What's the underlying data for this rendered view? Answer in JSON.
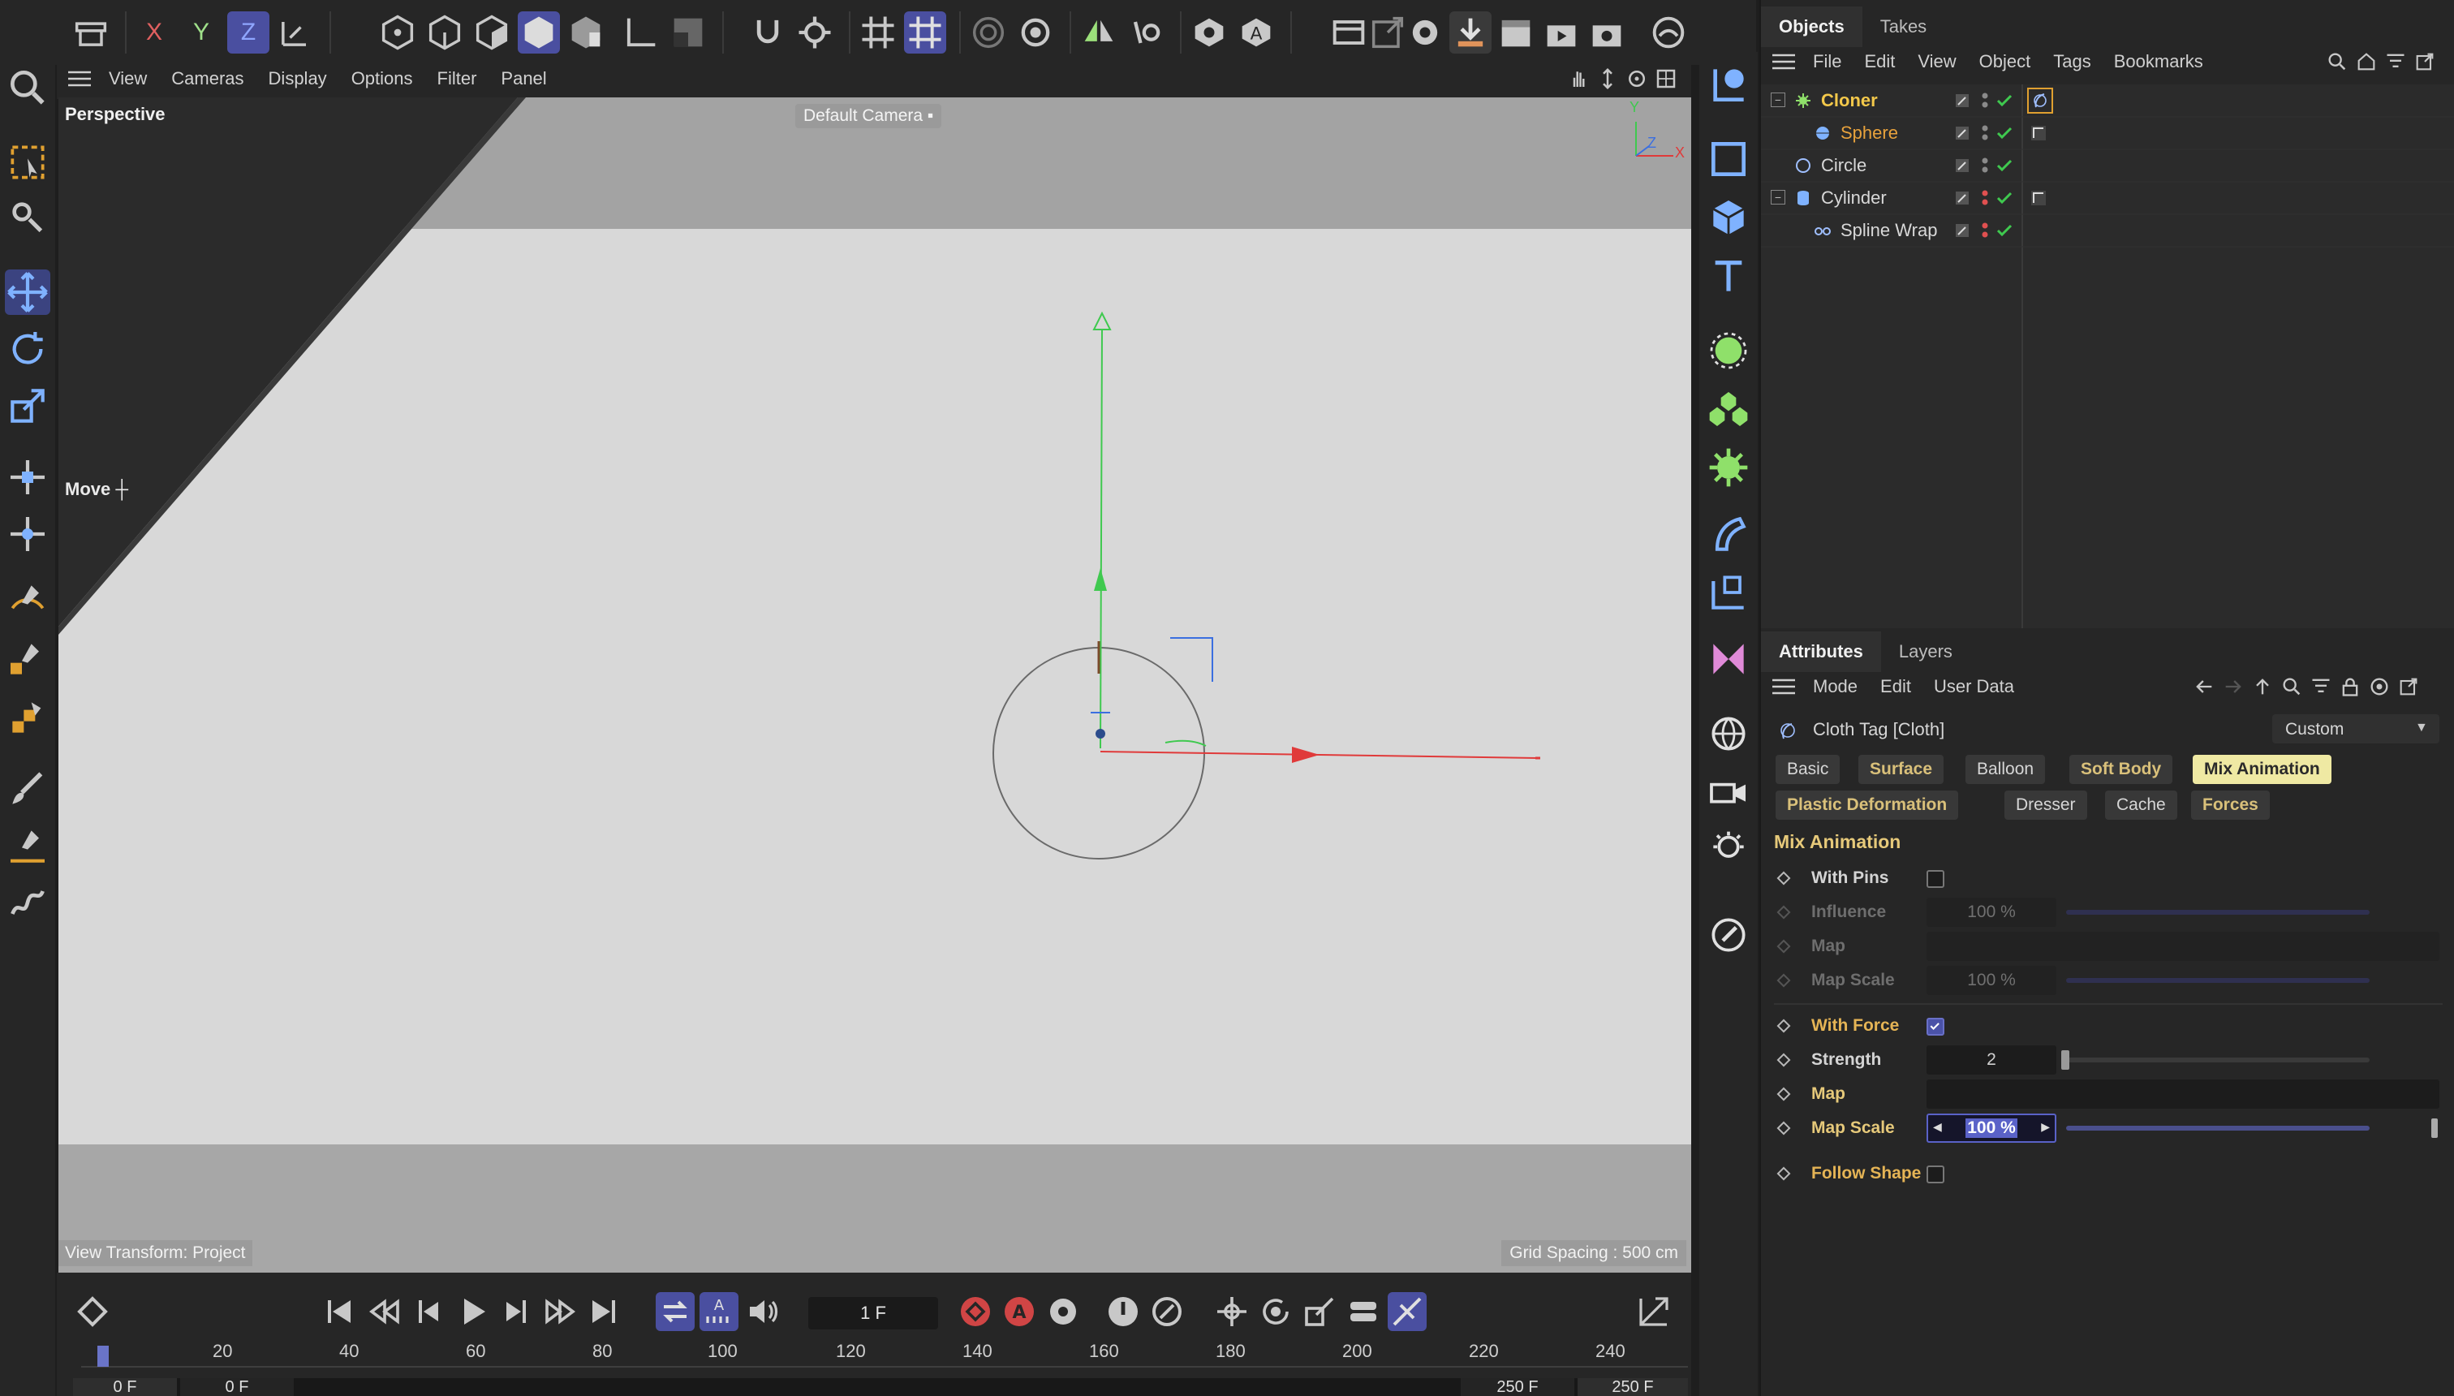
{
  "viewport": {
    "menu": [
      "View",
      "Cameras",
      "Display",
      "Options",
      "Filter",
      "Panel"
    ],
    "view_name": "Perspective",
    "camera": "Default Camera",
    "tool_name": "Move",
    "view_transform": "View Transform: Project",
    "grid_spacing": "Grid Spacing : 500 cm",
    "axes": {
      "y": "Y",
      "z": "Z",
      "x": "X"
    }
  },
  "top_toolbar": {
    "axis_buttons": [
      "X",
      "Y",
      "Z"
    ]
  },
  "timeline": {
    "current_frame": "1 F",
    "ruler_ticks": [
      "20",
      "40",
      "60",
      "80",
      "100",
      "120",
      "140",
      "160",
      "180",
      "200",
      "220",
      "240"
    ],
    "range_start": "0 F",
    "range_start_2": "0 F",
    "range_end": "250 F",
    "range_end_2": "250 F"
  },
  "objects_panel": {
    "tabs": [
      "Objects",
      "Takes"
    ],
    "menu": [
      "File",
      "Edit",
      "View",
      "Object",
      "Tags",
      "Bookmarks"
    ],
    "rows": [
      {
        "name": "Cloner"
      },
      {
        "name": "Sphere"
      },
      {
        "name": "Circle"
      },
      {
        "name": "Cylinder"
      },
      {
        "name": "Spline Wrap"
      }
    ]
  },
  "attributes_panel": {
    "tabs": [
      "Attributes",
      "Layers"
    ],
    "menu": [
      "Mode",
      "Edit",
      "User Data"
    ],
    "object_title": "Cloth Tag [Cloth]",
    "preset": "Custom",
    "tab_buttons_row1": [
      "Basic",
      "Surface",
      "Balloon",
      "Soft Body",
      "Mix Animation"
    ],
    "tab_buttons_row2": [
      "Plastic Deformation",
      "Dresser",
      "Cache",
      "Forces"
    ],
    "section_title": "Mix Animation",
    "params": {
      "with_pins": "With Pins",
      "influence": "Influence",
      "influence_value": "100 %",
      "influence_level": 1.0,
      "map": "Map",
      "map_scale": "Map Scale",
      "map_scale_value": "100 %",
      "map_scale_level": 1.0,
      "with_force": "With Force",
      "with_force_checked": true,
      "strength": "Strength",
      "strength_value": "2",
      "strength_level": 0.02,
      "map_2": "Map",
      "map_scale_2": "Map Scale",
      "map_scale_2_value": "100 %",
      "map_scale_2_level": 1.0,
      "follow_shape": "Follow Shape"
    }
  },
  "colors": {
    "accent": "#4a4fa0",
    "selected_object": "#f3c84a",
    "active_tab": "#efe9a3",
    "x_axis": "#e03a3a",
    "y_axis": "#3fc94f",
    "z_axis": "#3b6fe0",
    "check_green": "#3fc94f"
  }
}
